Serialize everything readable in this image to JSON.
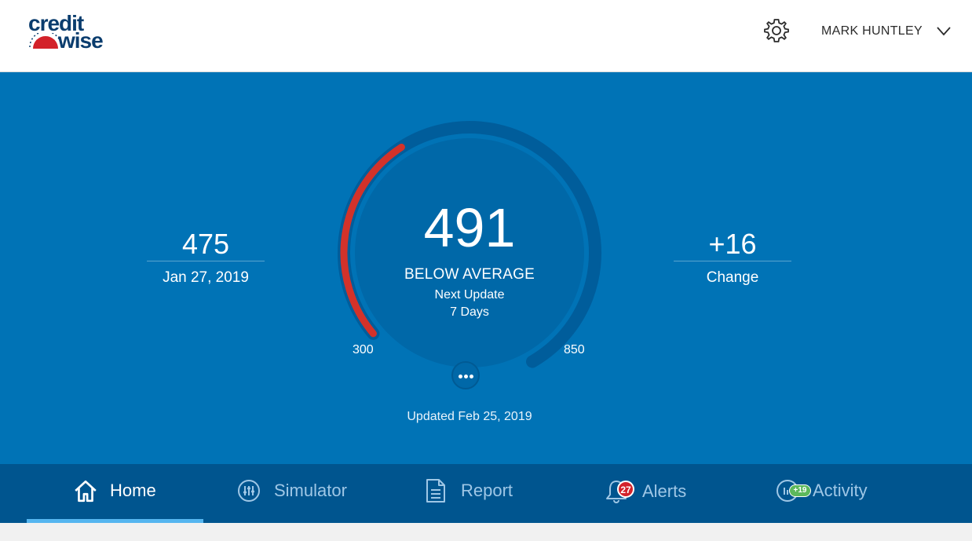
{
  "header": {
    "logo_line1": "credit",
    "logo_line2": "wise",
    "user_name": "MARK HUNTLEY",
    "settings_icon": "gear-icon",
    "menu_icon": "chevron-down-icon"
  },
  "hero": {
    "previous_score": "475",
    "previous_date": "Jan 27, 2019",
    "score": "491",
    "rating": "BELOW AVERAGE",
    "next_update_label": "Next Update",
    "next_update_value": "7 Days",
    "range_min": "300",
    "range_max": "850",
    "score_value": 491,
    "score_min": 300,
    "score_max": 850,
    "change": "+16",
    "change_label": "Change",
    "updated": "Updated Feb 25, 2019"
  },
  "nav": {
    "items": [
      {
        "label": "Home",
        "icon": "home-icon"
      },
      {
        "label": "Simulator",
        "icon": "sliders-icon"
      },
      {
        "label": "Report",
        "icon": "document-icon"
      },
      {
        "label": "Alerts",
        "icon": "bell-icon"
      },
      {
        "label": "Activity",
        "icon": "activity-icon"
      }
    ],
    "alerts_badge": "27",
    "activity_badge": "+19"
  },
  "colors": {
    "hero_bg": "#0073b6",
    "nav_bg": "#00558f",
    "gauge_fill": "#d3322a",
    "nav_active_underline": "#55b6f0",
    "brand_navy": "#0b3d6e",
    "brand_red": "#d3222a"
  }
}
